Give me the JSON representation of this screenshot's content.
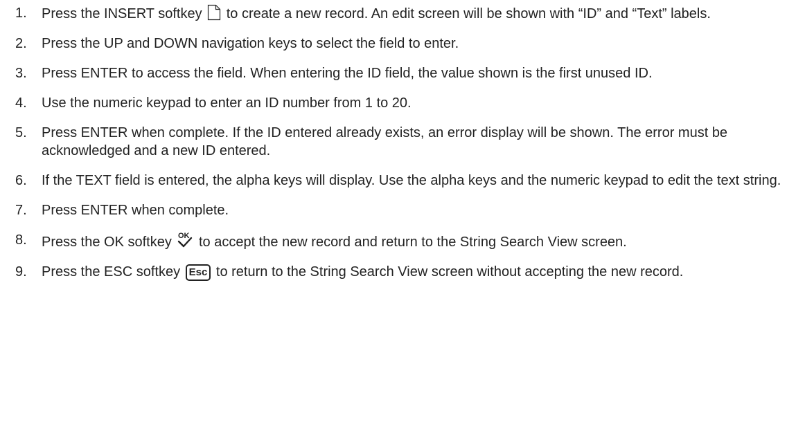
{
  "steps": [
    {
      "number": "1.",
      "parts": [
        "Press the INSERT softkey",
        "to create a new record. An edit screen will be shown with “ID” and “Text” labels."
      ]
    },
    {
      "number": "2.",
      "parts": [
        "Press the UP and DOWN navigation keys to select the field to enter."
      ]
    },
    {
      "number": "3.",
      "parts": [
        "Press ENTER to access the field. When entering the ID field, the value shown is the first unused ID."
      ]
    },
    {
      "number": "4.",
      "parts": [
        "Use the numeric keypad to enter an ID number from 1 to 20."
      ]
    },
    {
      "number": "5.",
      "parts": [
        "Press ENTER when complete. If the ID entered already exists, an error display will be shown. The error must be acknowledged and a new ID entered."
      ]
    },
    {
      "number": "6.",
      "parts": [
        "If the TEXT field is entered, the alpha keys will display. Use the alpha keys and the numeric keypad to edit the text string."
      ]
    },
    {
      "number": "7.",
      "parts": [
        "Press ENTER when complete."
      ]
    },
    {
      "number": "8.",
      "parts": [
        "Press the OK softkey",
        "to accept the new record and return to the String Search View screen."
      ]
    },
    {
      "number": "9.",
      "parts": [
        "Press the ESC softkey",
        "to return to the String Search View screen without accepting the new record."
      ]
    }
  ],
  "icons": {
    "insert": "insert-document-icon",
    "ok": "ok-checkmark-icon",
    "esc": "esc-key-icon",
    "ok_text": "OK",
    "esc_text": "Esc"
  }
}
